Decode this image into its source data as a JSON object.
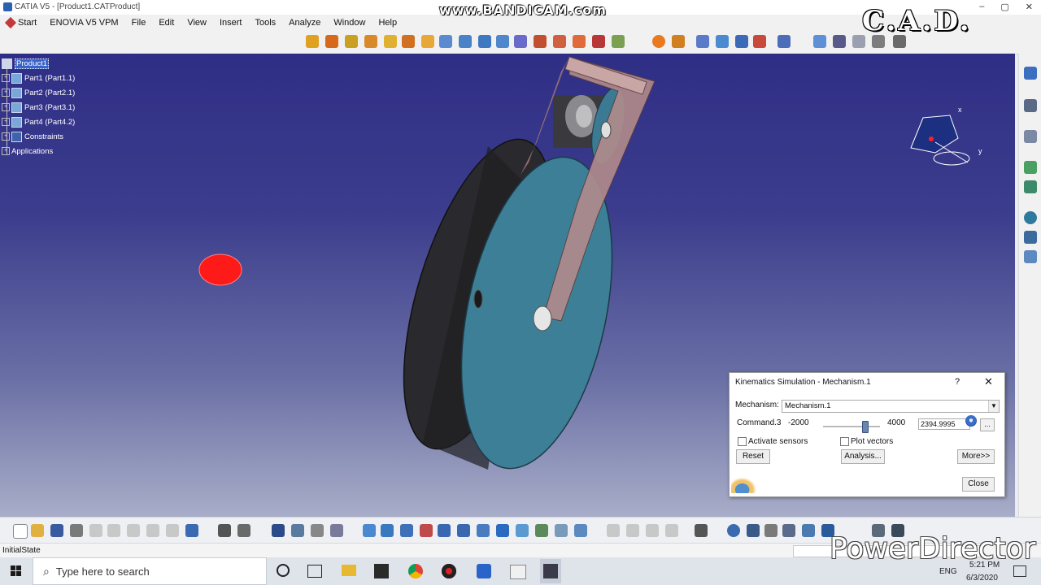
{
  "window": {
    "title": "CATIA V5 - [Product1.CATProduct]"
  },
  "watermarks": {
    "bandicam": "www.BANDICAM.com",
    "cad": "C.A.D.",
    "powerdirector": "PowerDirector"
  },
  "menu": {
    "start": "Start",
    "items": [
      "ENOVIA V5 VPM",
      "File",
      "Edit",
      "View",
      "Insert",
      "Tools",
      "Analyze",
      "Window",
      "Help"
    ]
  },
  "tree": {
    "root": "Product1",
    "parts": [
      "Part1 (Part1.1)",
      "Part2 (Part2.1)",
      "Part3 (Part3.1)",
      "Part4 (Part4.2)"
    ],
    "constraints": "Constraints",
    "applications": "Applications"
  },
  "compass": {
    "x_label": "x",
    "y_label": "y"
  },
  "dialog": {
    "title": "Kinematics Simulation - Mechanism.1",
    "help": "?",
    "mechanism_label": "Mechanism:",
    "mechanism_value": "Mechanism.1",
    "command_label": "Command.3",
    "min": "-2000",
    "max": "4000",
    "value": "2394.9995",
    "slider_fraction": 0.732,
    "dots": "...",
    "activate_sensors": "Activate sensors",
    "plot_vectors": "Plot vectors",
    "reset": "Reset",
    "analysis": "Analysis...",
    "more": "More>>",
    "close": "Close"
  },
  "status": {
    "text": "InitialState"
  },
  "taskbar": {
    "search_placeholder": "Type here to search",
    "lang": "ENG",
    "time": "5:21 PM",
    "date": "6/3/2020"
  },
  "colors": {
    "accent": "#3b63c5",
    "viewport_top": "#2f2e86",
    "part_dark": "#2c2c30",
    "part_teal": "#3a7d96",
    "link": "#b78a8a"
  }
}
